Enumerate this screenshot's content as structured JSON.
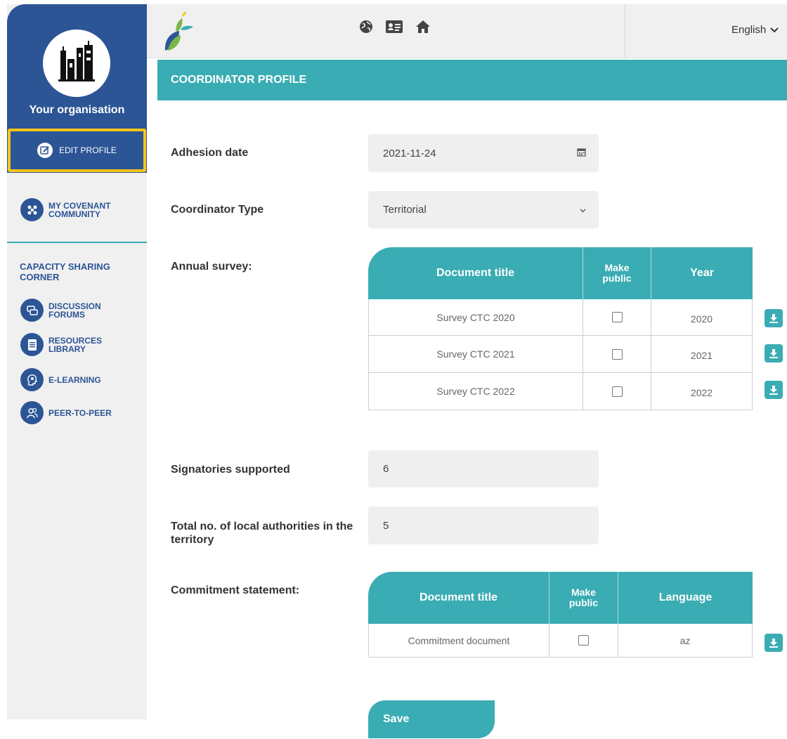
{
  "sidebar": {
    "org_name": "Your  organisation",
    "edit_profile": "EDIT PROFILE",
    "my_covenant": "MY COVENANT COMMUNITY",
    "section_title": "CAPACITY SHARING CORNER",
    "items": [
      {
        "label": "DISCUSSION FORUMS",
        "icon": "chat-icon"
      },
      {
        "label": "RESOURCES LIBRARY",
        "icon": "document-icon"
      },
      {
        "label": "E-LEARNING",
        "icon": "head-gear-icon"
      },
      {
        "label": "PEER-TO-PEER",
        "icon": "people-icon"
      }
    ]
  },
  "topbar": {
    "language": "English",
    "icons": [
      "globe-icon",
      "id-card-icon",
      "home-icon"
    ]
  },
  "page_title": "COORDINATOR PROFILE",
  "form": {
    "adhesion_label": "Adhesion date",
    "adhesion_value": "2021-11-24",
    "coord_type_label": "Coordinator Type",
    "coord_type_value": "Territorial",
    "annual_survey_label": "Annual survey:",
    "survey_table": {
      "headers": [
        "Document title",
        "Make public",
        "Year"
      ],
      "rows": [
        {
          "title": "Survey CTC 2020",
          "public": false,
          "year": "2020"
        },
        {
          "title": "Survey CTC 2021",
          "public": false,
          "year": "2021"
        },
        {
          "title": "Survey CTC 2022",
          "public": false,
          "year": "2022"
        }
      ]
    },
    "signatories_label": "Signatories supported",
    "signatories_value": "6",
    "local_auth_label": "Total no. of local authorities in the territory",
    "local_auth_value": "5",
    "commitment_label": "Commitment statement:",
    "commitment_table": {
      "headers": [
        "Document title",
        "Make public",
        "Language"
      ],
      "rows": [
        {
          "title": "Commitment document",
          "public": false,
          "language": "az"
        }
      ]
    },
    "save_label": "Save"
  },
  "colors": {
    "brand_blue": "#2c5596",
    "teal": "#3aacb3",
    "highlight": "#f5c518"
  }
}
